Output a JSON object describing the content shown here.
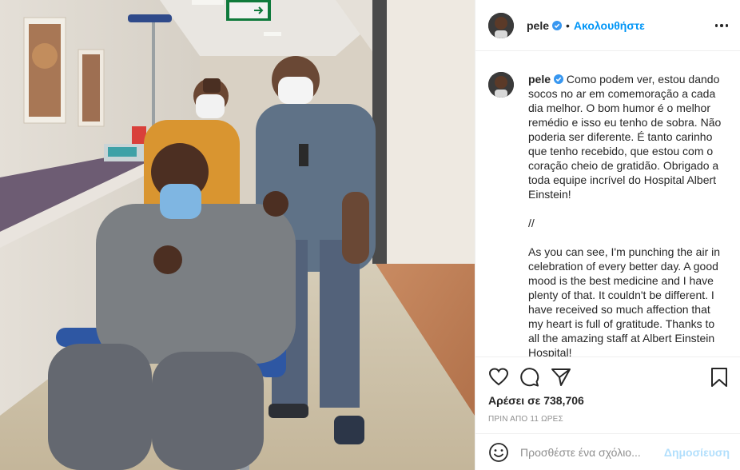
{
  "post": {
    "image_alt": "Pele seated in a wheelchair in a hospital corridor with two medical staff"
  },
  "header": {
    "username": "pele",
    "separator": "•",
    "follow_label": "Ακολουθήστε",
    "more_icon": "more-options-icon"
  },
  "caption": {
    "username": "pele",
    "portuguese": "Como podem ver, estou dando socos no ar em comemoração a cada dia melhor. O bom humor é o melhor remédio e isso eu tenho de sobra. Não poderia ser diferente. É tanto carinho que tenho recebido, que estou com o coração cheio de gratidão. Obrigado a toda equipe incrível do Hospital Albert Einstein!",
    "divider": "//",
    "english": "As you can see, I'm punching the air in celebration of every better day. A good mood is the best medicine and I have plenty of that. It couldn't be different. I have received so much affection that my heart is full of gratitude. Thanks to all the amazing staff at Albert Einstein Hospital!"
  },
  "actions": {
    "icons": [
      "heart-icon",
      "comment-icon",
      "share-icon",
      "bookmark-icon"
    ],
    "likes_text": "Αρέσει σε 738,706",
    "time_text": "ΠΡΙΝ ΑΠΟ 11 ΩΡΕΣ"
  },
  "comment": {
    "placeholder": "Προσθέστε ένα σχόλιο...",
    "post_label": "Δημοσίευση"
  },
  "colors": {
    "accent": "#0095f6",
    "post_disabled": "#b2dffc",
    "verified": "#3897f0"
  }
}
